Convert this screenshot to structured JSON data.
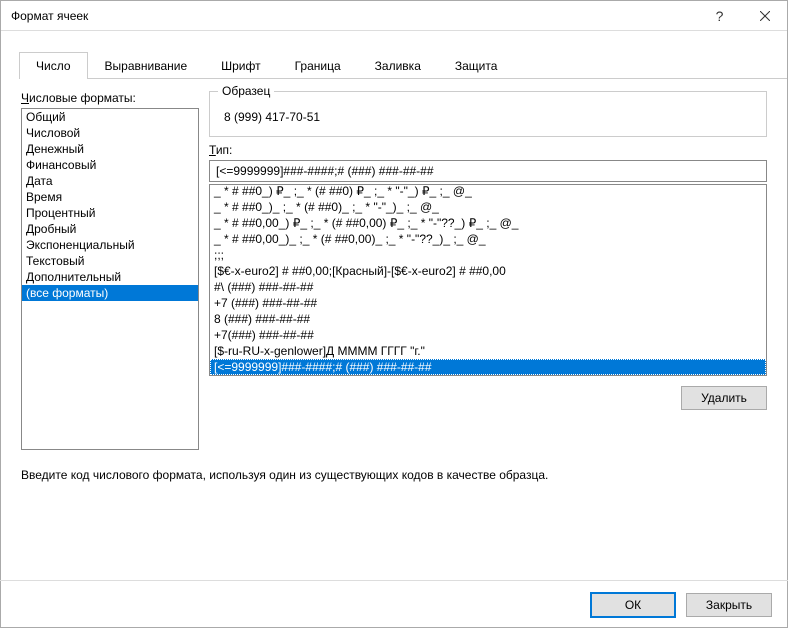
{
  "titlebar": {
    "title": "Формат ячеек"
  },
  "tabs": [
    {
      "label": "Число",
      "active": true
    },
    {
      "label": "Выравнивание",
      "active": false
    },
    {
      "label": "Шрифт",
      "active": false
    },
    {
      "label": "Граница",
      "active": false
    },
    {
      "label": "Заливка",
      "active": false
    },
    {
      "label": "Защита",
      "active": false
    }
  ],
  "labels": {
    "category": "Числовые форматы:",
    "sample": "Образец",
    "type": "Тип:",
    "delete": "Удалить",
    "hint": "Введите код числового формата, используя один из существующих кодов в качестве образца.",
    "ok": "ОК",
    "close": "Закрыть"
  },
  "sample_value": "8 (999) 417-70-51",
  "type_value": "[<=9999999]###-####;# (###) ###-##-##",
  "categories": [
    "Общий",
    "Числовой",
    "Денежный",
    "Финансовый",
    "Дата",
    "Время",
    "Процентный",
    "Дробный",
    "Экспоненциальный",
    "Текстовый",
    "Дополнительный",
    "(все форматы)"
  ],
  "category_selected_index": 11,
  "formats": [
    "_ * # ##0_) ₽_ ;_ * (# ##0) ₽_ ;_ * \"-\"_) ₽_ ;_ @_",
    "_ * # ##0_)_ ;_ * (# ##0)_ ;_ * \"-\"_)_ ;_ @_",
    "_ * # ##0,00_) ₽_ ;_ * (# ##0,00) ₽_ ;_ * \"-\"??_) ₽_ ;_ @_",
    "_ * # ##0,00_)_ ;_ * (# ##0,00)_ ;_ * \"-\"??_)_ ;_ @_",
    ";;;",
    "[$€-x-euro2] # ##0,00;[Красный]-[$€-x-euro2] # ##0,00",
    "#\\ (###) ###-##-##",
    "+7 (###) ###-##-##",
    "8 (###) ###-##-##",
    "+7(###) ###-##-##",
    "[$-ru-RU-x-genlower]Д ММММ ГГГГ \"г.\"",
    "[<=9999999]###-####;# (###) ###-##-##"
  ],
  "format_selected_index": 11
}
